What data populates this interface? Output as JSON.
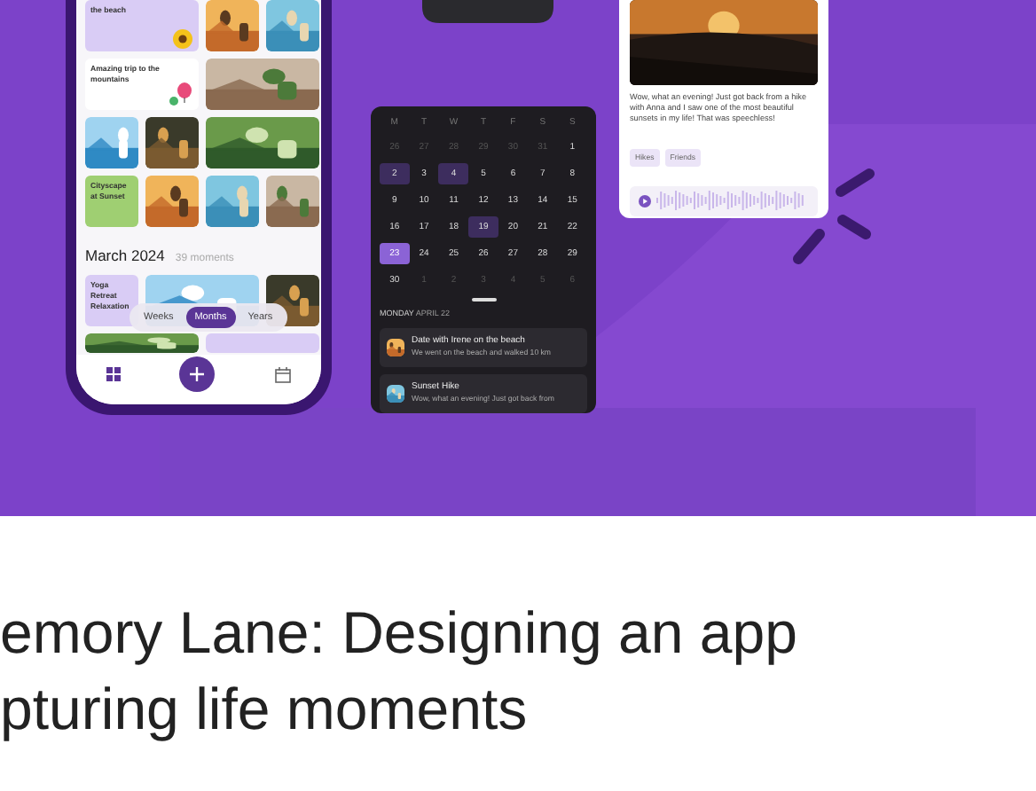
{
  "phone": {
    "tiles": [
      {
        "kind": "text",
        "text": "the beach",
        "color": "#d9ccf5"
      },
      {
        "kind": "picture"
      },
      {
        "kind": "picture"
      },
      {
        "kind": "text",
        "text": "Amazing trip to the mountains",
        "color": "#ffffff"
      },
      {
        "kind": "picture"
      },
      {
        "kind": "picture"
      },
      {
        "kind": "picture"
      },
      {
        "kind": "picture"
      },
      {
        "kind": "text",
        "text": "Cityscape at Sunset",
        "color": "#9fcf72"
      },
      {
        "kind": "picture"
      },
      {
        "kind": "picture"
      },
      {
        "kind": "picture"
      }
    ],
    "section": {
      "title": "March 2024",
      "count": "39 moments"
    },
    "tiles2": [
      {
        "kind": "text",
        "text": "Yoga Retreat Relaxation",
        "color": "#d9ccf5"
      },
      {
        "kind": "picture"
      },
      {
        "kind": "picture"
      },
      {
        "kind": "picture"
      },
      {
        "kind": "text",
        "color": "#d9ccf5"
      }
    ],
    "segments": [
      {
        "label": "Weeks",
        "selected": false
      },
      {
        "label": "Months",
        "selected": true
      },
      {
        "label": "Years",
        "selected": false
      }
    ]
  },
  "calendar": {
    "weekdays": [
      "M",
      "T",
      "W",
      "T",
      "F",
      "S",
      "S"
    ],
    "days": [
      {
        "label": "26",
        "muted": true,
        "marked": false,
        "selected": false
      },
      {
        "label": "27",
        "muted": true,
        "marked": false,
        "selected": false
      },
      {
        "label": "28",
        "muted": true,
        "marked": false,
        "selected": false
      },
      {
        "label": "29",
        "muted": true,
        "marked": false,
        "selected": false
      },
      {
        "label": "30",
        "muted": true,
        "marked": false,
        "selected": false
      },
      {
        "label": "31",
        "muted": true,
        "marked": false,
        "selected": false
      },
      {
        "label": "1",
        "muted": false,
        "marked": false,
        "selected": false
      },
      {
        "label": "2",
        "muted": false,
        "marked": true,
        "selected": false
      },
      {
        "label": "3",
        "muted": false,
        "marked": false,
        "selected": false
      },
      {
        "label": "4",
        "muted": false,
        "marked": true,
        "selected": false
      },
      {
        "label": "5",
        "muted": false,
        "marked": false,
        "selected": false
      },
      {
        "label": "6",
        "muted": false,
        "marked": false,
        "selected": false
      },
      {
        "label": "7",
        "muted": false,
        "marked": false,
        "selected": false
      },
      {
        "label": "8",
        "muted": false,
        "marked": false,
        "selected": false
      },
      {
        "label": "9",
        "muted": false,
        "marked": false,
        "selected": false
      },
      {
        "label": "10",
        "muted": false,
        "marked": false,
        "selected": false
      },
      {
        "label": "11",
        "muted": false,
        "marked": false,
        "selected": false
      },
      {
        "label": "12",
        "muted": false,
        "marked": false,
        "selected": false
      },
      {
        "label": "13",
        "muted": false,
        "marked": false,
        "selected": false
      },
      {
        "label": "14",
        "muted": false,
        "marked": false,
        "selected": false
      },
      {
        "label": "15",
        "muted": false,
        "marked": false,
        "selected": false
      },
      {
        "label": "16",
        "muted": false,
        "marked": false,
        "selected": false
      },
      {
        "label": "17",
        "muted": false,
        "marked": false,
        "selected": false
      },
      {
        "label": "18",
        "muted": false,
        "marked": false,
        "selected": false
      },
      {
        "label": "19",
        "muted": false,
        "marked": true,
        "selected": false
      },
      {
        "label": "20",
        "muted": false,
        "marked": false,
        "selected": false
      },
      {
        "label": "21",
        "muted": false,
        "marked": false,
        "selected": false
      },
      {
        "label": "22",
        "muted": false,
        "marked": false,
        "selected": false
      },
      {
        "label": "23",
        "muted": false,
        "marked": false,
        "selected": true
      },
      {
        "label": "24",
        "muted": false,
        "marked": false,
        "selected": false
      },
      {
        "label": "25",
        "muted": false,
        "marked": false,
        "selected": false
      },
      {
        "label": "26",
        "muted": false,
        "marked": false,
        "selected": false
      },
      {
        "label": "27",
        "muted": false,
        "marked": false,
        "selected": false
      },
      {
        "label": "28",
        "muted": false,
        "marked": false,
        "selected": false
      },
      {
        "label": "29",
        "muted": false,
        "marked": false,
        "selected": false
      },
      {
        "label": "30",
        "muted": false,
        "marked": false,
        "selected": false
      },
      {
        "label": "1",
        "muted": true,
        "marked": false,
        "selected": false
      },
      {
        "label": "2",
        "muted": true,
        "marked": false,
        "selected": false
      },
      {
        "label": "3",
        "muted": true,
        "marked": false,
        "selected": false
      },
      {
        "label": "4",
        "muted": true,
        "marked": false,
        "selected": false
      },
      {
        "label": "5",
        "muted": true,
        "marked": false,
        "selected": false
      },
      {
        "label": "6",
        "muted": true,
        "marked": false,
        "selected": false
      }
    ],
    "weekday": "MONDAY",
    "date": "APRIL 22",
    "entries": [
      {
        "title": "Date with Irene on the beach",
        "text": "We went on the beach and walked 10 km"
      },
      {
        "title": "Sunset Hike",
        "text": "Wow, what an evening! Just got back from"
      }
    ]
  },
  "entry_card": {
    "text": "Wow, what an evening! Just got back from a hike with Anna and I saw one of the most beautiful sunsets in my life! That was speechless!",
    "tags": [
      "Hikes",
      "Friends"
    ]
  },
  "heading": [
    "emory Lane: Designing an app",
    "pturing life moments"
  ]
}
